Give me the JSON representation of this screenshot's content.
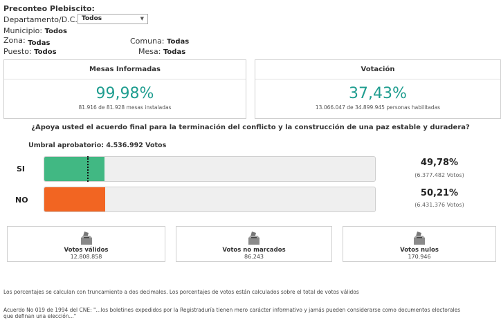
{
  "header": {
    "title": "Preconteo Plebiscito:"
  },
  "filters": {
    "departamento": {
      "label": "Departamento/D.C.:",
      "value": "Todos"
    },
    "municipio": {
      "label": "Municipio:",
      "value": "Todos"
    },
    "zona": {
      "label": "Zona:",
      "value": "Todas"
    },
    "comuna": {
      "label": "Comuna:",
      "value": "Todas"
    },
    "puesto": {
      "label": "Puesto:",
      "value": "Todos"
    },
    "mesa": {
      "label": "Mesa:",
      "value": "Todas"
    }
  },
  "mesas": {
    "title": "Mesas Informadas",
    "percent": "99,98%",
    "detail": "81.916 de 81.928 mesas instaladas"
  },
  "votacion": {
    "title": "Votación",
    "percent": "37,43%",
    "detail": "13.066.047 de 34.899.945 personas habilitadas"
  },
  "question": "¿Apoya usted el acuerdo final para la terminación del conflicto y la construcción de una paz estable y duradera?",
  "threshold": {
    "text": "Umbral aprobatorio: 4.536.992 Votos",
    "fraction": 0.1307
  },
  "results": {
    "si": {
      "label": "SI",
      "percent": "49,78%",
      "votes": "(6.377.482 Votos)",
      "fill": 0.1826,
      "color": "#41b883"
    },
    "no": {
      "label": "NO",
      "percent": "50,21%",
      "votes": "(6.431.376 Votos)",
      "fill": 0.1842,
      "color": "#f26522"
    }
  },
  "totals": {
    "validos": {
      "title": "Votos válidos",
      "value": "12.808.858"
    },
    "no_marcados": {
      "title": "Votos no marcados",
      "value": "86.243"
    },
    "nulos": {
      "title": "Votos nulos",
      "value": "170.946"
    }
  },
  "footer": {
    "note": "Los porcentajes se calculan con truncamiento a dos decimales. Los porcentajes de votos están calculados sobre el total de votos válidos",
    "legal_1": "Acuerdo No 019 de 1994 del CNE: \"...los boletines expedidos por la Registraduría tienen mero carácter informativo y jamás pueden considerarse como documentos electorales",
    "legal_2": "que definan una elección...\""
  }
}
